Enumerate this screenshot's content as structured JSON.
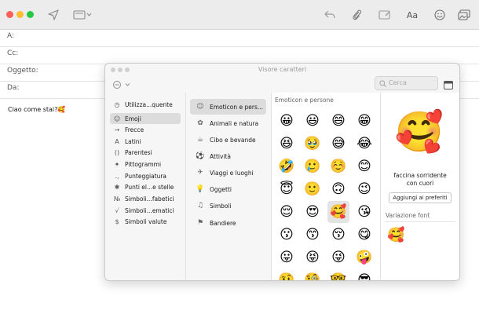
{
  "mail": {
    "fields": [
      {
        "label": "A:"
      },
      {
        "label": "Cc:"
      },
      {
        "label": "Oggetto:"
      },
      {
        "label": "Da:"
      }
    ],
    "body": "Ciao come stai?🥰",
    "toolbar_icons": [
      "send-icon",
      "header-fields-icon",
      "reply-icon",
      "attach-icon",
      "markup-icon",
      "format-icon",
      "emoji-icon",
      "photo-icon"
    ],
    "format_label": "Aa"
  },
  "viewer": {
    "title": "Visore caratteri",
    "search_placeholder": "Cerca",
    "left_items": [
      {
        "label": "Utilizza...quente",
        "icon": "◷"
      },
      {
        "label": "Emoji",
        "icon": "☺"
      },
      {
        "label": "Frecce",
        "icon": "→"
      },
      {
        "label": "Latini",
        "icon": "A"
      },
      {
        "label": "Parentesi",
        "icon": "()"
      },
      {
        "label": "Pittogrammi",
        "icon": "✦"
      },
      {
        "label": "Punteggiatura",
        "icon": ".,"
      },
      {
        "label": "Punti el...e stelle",
        "icon": "✱"
      },
      {
        "label": "Simboli...fabetici",
        "icon": "№"
      },
      {
        "label": "Simboli...ematici",
        "icon": "√"
      },
      {
        "label": "Simboli valute",
        "icon": "$"
      }
    ],
    "selected_left": 1,
    "categories": [
      {
        "label": "Emoticon e pers...",
        "icon": "☺"
      },
      {
        "label": "Animali e natura",
        "icon": "✿"
      },
      {
        "label": "Cibo e bevande",
        "icon": "☕"
      },
      {
        "label": "Attività",
        "icon": "⚽"
      },
      {
        "label": "Viaggi e luoghi",
        "icon": "✈"
      },
      {
        "label": "Oggetti",
        "icon": "💡"
      },
      {
        "label": "Simboli",
        "icon": "♫"
      },
      {
        "label": "Bandiere",
        "icon": "⚑"
      }
    ],
    "selected_category": 0,
    "grid_title": "Emoticon e persone",
    "emojis": [
      "😀",
      "😃",
      "😄",
      "😁",
      "😆",
      "🥹",
      "😅",
      "😂",
      "🤣",
      "🥲",
      "☺️",
      "😊",
      "😇",
      "🙂",
      "🙃",
      "😉",
      "😌",
      "😍",
      "🥰",
      "😘",
      "😗",
      "😙",
      "😚",
      "😋",
      "😛",
      "😝",
      "😜",
      "🤪",
      "🤨",
      "🧐",
      "🤓",
      "😎"
    ],
    "selected_emoji": 18,
    "detail": {
      "preview": "🥰",
      "name_line1": "faccina sorridente",
      "name_line2": "con cuori",
      "add_favorite": "Aggiungi ai preferiti",
      "font_variation_title": "Variazione font",
      "font_variation": "🥰"
    }
  },
  "colors": {
    "close": "#fe5f57",
    "minimize": "#febc2e",
    "zoom": "#28c840",
    "selection": "#dcdcdc"
  }
}
